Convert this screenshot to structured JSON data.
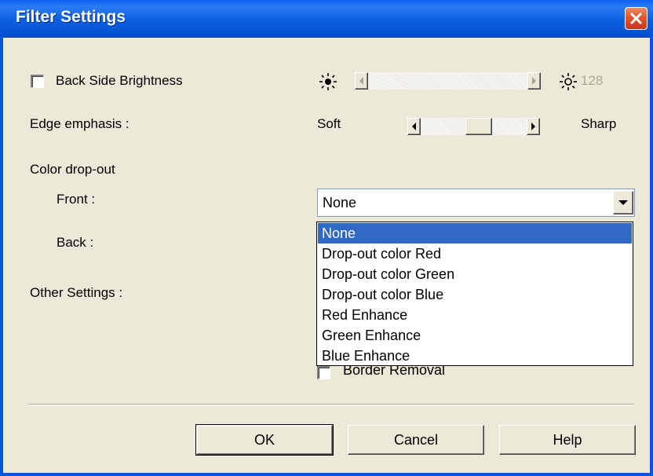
{
  "window": {
    "title": "Filter Settings"
  },
  "back_side_brightness": {
    "label": "Back Side Brightness",
    "checked": false,
    "value": "128",
    "enabled": false
  },
  "edge_emphasis": {
    "label": "Edge emphasis :",
    "min_label": "Soft",
    "max_label": "Sharp",
    "position_fraction": 0.5
  },
  "color_dropout": {
    "heading": "Color drop-out",
    "front_label": "Front :",
    "back_label": "Back :",
    "front_value": "None",
    "options": [
      "None",
      "Drop-out color Red",
      "Drop-out color Green",
      "Drop-out color Blue",
      "Red Enhance",
      "Green Enhance",
      "Blue Enhance"
    ],
    "selected_index": 0
  },
  "other_settings": {
    "label": "Other Settings :",
    "border_removal_label": "Border Removal",
    "border_removal_checked": false
  },
  "buttons": {
    "ok": "OK",
    "cancel": "Cancel",
    "help": "Help"
  },
  "colors": {
    "titlebar": "#0a5ee8",
    "selection": "#316ac5",
    "dialog_bg": "#ece9d8",
    "close_button": "#e0542d"
  },
  "icons": [
    "sun-dim-icon",
    "sun-bright-icon",
    "close-icon",
    "arrow-left-icon",
    "arrow-right-icon",
    "dropdown-arrow-icon"
  ]
}
